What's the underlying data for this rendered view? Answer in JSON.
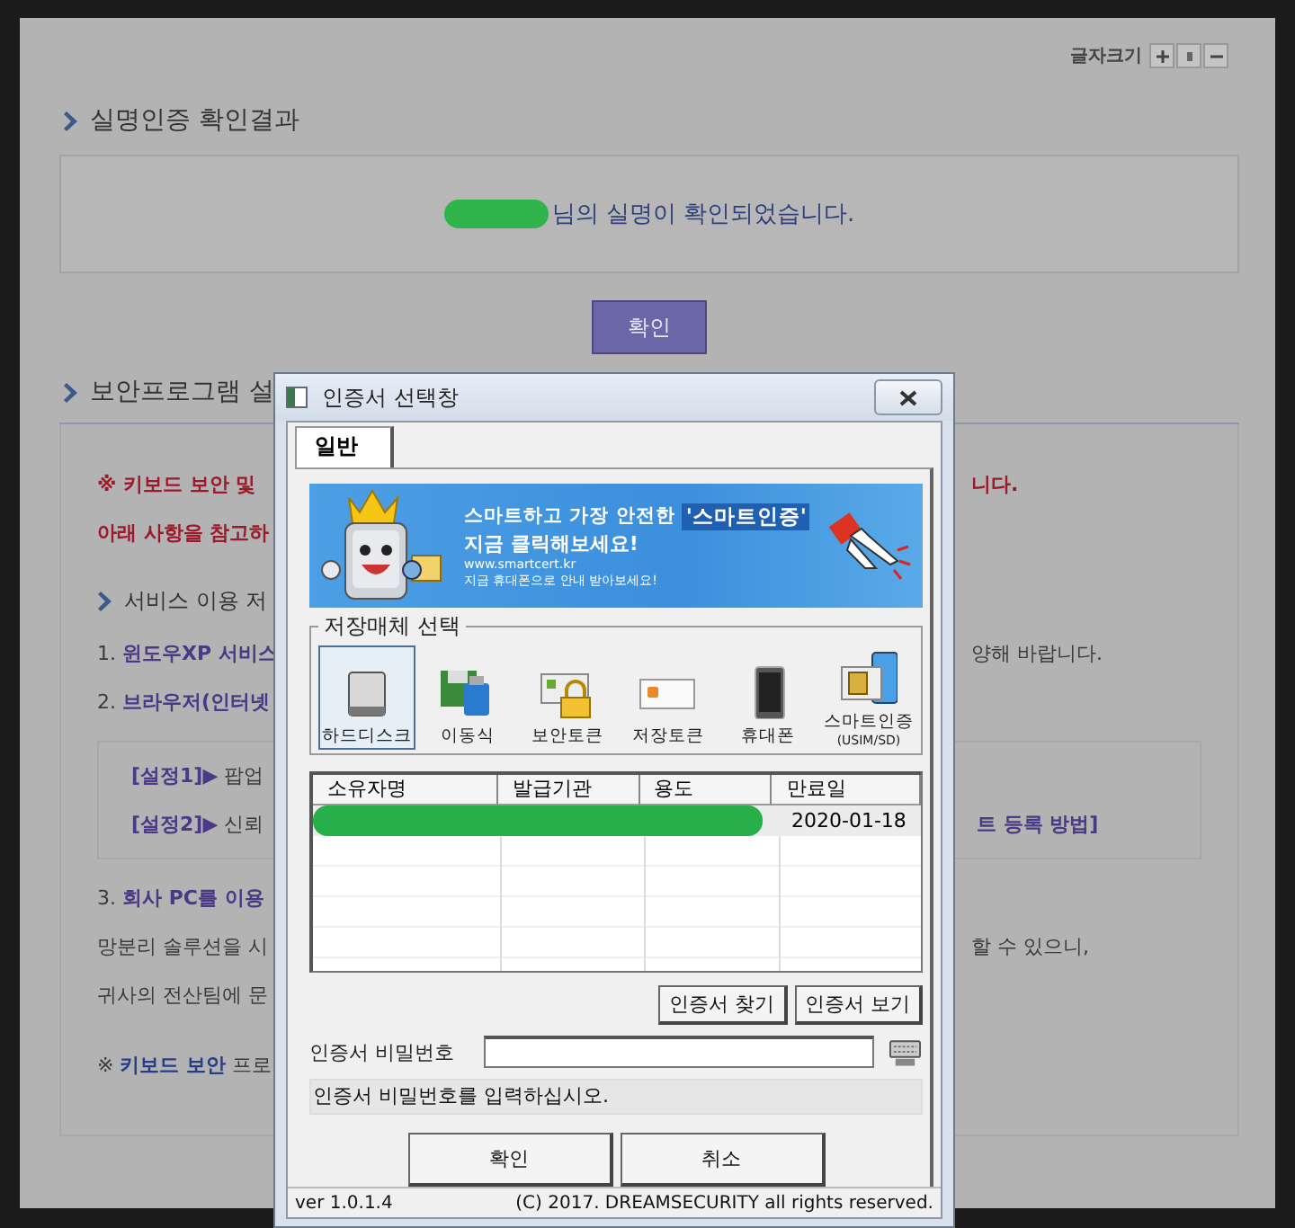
{
  "page": {
    "text_size_label": "글자크기",
    "result_section": {
      "title": "실명인증 확인결과",
      "message": "님의 실명이 확인되었습니다.",
      "name_redacted": true,
      "confirm_button": "확인"
    },
    "security_section": {
      "title": "보안프로그램 설",
      "lines": [
        {
          "kind": "notice",
          "left": "※ 키보드 보안 및 ",
          "right": "니다."
        },
        {
          "kind": "notice",
          "left": "아래 사항을 참고하"
        },
        {
          "kind": "heading",
          "left": "서비스 이용 저"
        },
        {
          "kind": "item",
          "left": "1. **윈도우XP 서비스**",
          "right": "양해 바랍니다."
        },
        {
          "kind": "item",
          "left": "2. **브라우저(인터넷**"
        },
        {
          "kind": "setting",
          "left": "**[설정1]▶** 팝업"
        },
        {
          "kind": "setting",
          "left": "**[설정2]▶** 신뢰",
          "right": "**트 등록 방법]**"
        },
        {
          "kind": "item",
          "left": "3. **회사 PC를 이용**"
        },
        {
          "kind": "body",
          "left": "망분리 솔루션을 시",
          "right": "할 수 있으니,"
        },
        {
          "kind": "body",
          "left": "귀사의 전산팀에 문"
        },
        {
          "kind": "footnote",
          "left": "※ **키보드 보안** 프로"
        }
      ]
    }
  },
  "dialog": {
    "title": "인증서 선택창",
    "tabs": [
      {
        "label": "일반",
        "selected": true
      }
    ],
    "banner": {
      "headline": "스마트하고 가장 안전한",
      "highlight": "'스마트인증'",
      "subline": "지금 클릭해보세요!",
      "url": "www.smartcert.kr",
      "note": "지금 휴대폰으로 안내 받아보세요!"
    },
    "media_group": {
      "title": "저장매체 선택",
      "items": [
        {
          "label": "하드디스크",
          "selected": true
        },
        {
          "label": "이동식",
          "selected": false
        },
        {
          "label": "보안토큰",
          "selected": false
        },
        {
          "label": "저장토큰",
          "selected": false
        },
        {
          "label": "휴대폰",
          "selected": false
        },
        {
          "label": "스마트인증",
          "sublabel": "(USIM/SD)",
          "selected": false
        }
      ]
    },
    "certificates": {
      "columns": [
        "소유자명",
        "발급기관",
        "용도",
        "만료일"
      ],
      "rows": [
        {
          "expiry": "2020-01-18",
          "selected": true,
          "redacted": true
        }
      ]
    },
    "find_button": "인증서 찾기",
    "view_button": "인증서 보기",
    "password": {
      "label": "인증서 비밀번호"
    },
    "message": "인증서 비밀번호를 입력하십시오.",
    "buttons": [
      "확인",
      "취소"
    ],
    "status_bar": {
      "version": "ver 1.0.1.4",
      "copyright": "(C) 2017. DREAMSECURITY all rights reserved."
    }
  }
}
